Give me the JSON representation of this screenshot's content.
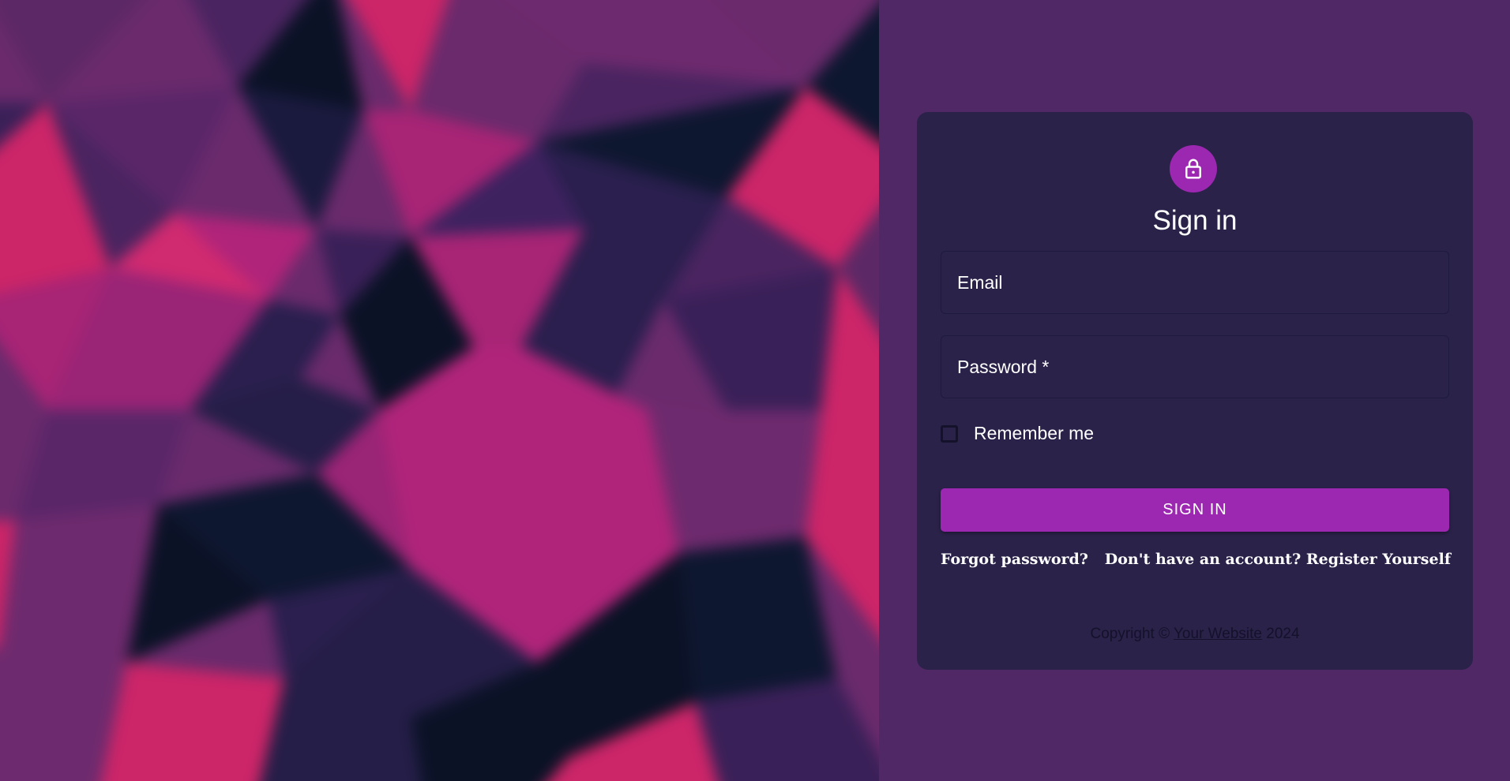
{
  "colors": {
    "page_background": "#502866",
    "card_background": "#2a2249",
    "accent": "#9c27b0",
    "text": "#ffffff",
    "muted_text": "#14112a"
  },
  "hero": {
    "icon": "abstract-polygon-background"
  },
  "header": {
    "icon": "lock-icon",
    "title": "Sign in"
  },
  "form": {
    "email_label": "Email",
    "password_label": "Password *",
    "remember_label": "Remember me",
    "remember_checked": false,
    "submit_label": "SIGN IN"
  },
  "links": {
    "forgot": "Forgot password?",
    "register": "Don't have an account? Register Yourself"
  },
  "footer": {
    "prefix": "Copyright © ",
    "link": "Your Website",
    "suffix": " 2024"
  }
}
